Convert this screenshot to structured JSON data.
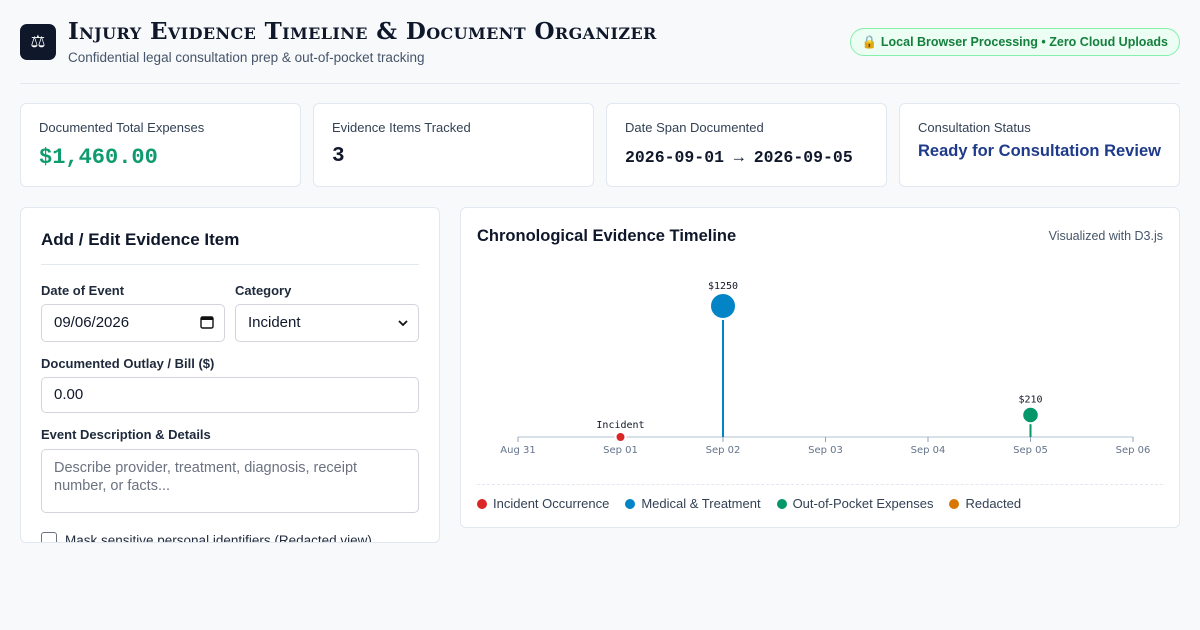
{
  "header": {
    "title": "Injury Evidence Timeline & Document Organizer",
    "subtitle": "Confidential legal consultation prep & out-of-pocket tracking",
    "logo_icon": "scales-icon",
    "privacy_badge": "🔒 Local Browser Processing • Zero Cloud Uploads"
  },
  "stats": [
    {
      "label": "Documented Total Expenses",
      "value": "$1,460.00"
    },
    {
      "label": "Evidence Items Tracked",
      "value": "3"
    },
    {
      "label": "Date Span Documented",
      "value": "2026-09-01 → 2026-09-05"
    },
    {
      "label": "Consultation Status",
      "value": "Ready for Consultation Review"
    }
  ],
  "form": {
    "title": "Add / Edit Evidence Item",
    "date_label": "Date of Event",
    "date_value": "09/06/2026",
    "category_label": "Category",
    "category_value": "Incident",
    "amount_label": "Documented Outlay / Bill ($)",
    "amount_value": "0.00",
    "description_label": "Event Description & Details",
    "description_placeholder": "Describe provider, treatment, diagnosis, receipt number, or facts...",
    "mask_label": "Mask sensitive personal identifiers (Redacted view)"
  },
  "timeline": {
    "title": "Chronological Evidence Timeline",
    "note": "Visualized with D3.js",
    "colors": {
      "incident": "#dc2626",
      "medical": "#0284c7",
      "expense": "#059669",
      "redacted": "#d97706"
    },
    "legend": [
      {
        "key": "incident",
        "label": "Incident Occurrence"
      },
      {
        "key": "medical",
        "label": "Medical & Treatment"
      },
      {
        "key": "expense",
        "label": "Out-of-Pocket Expenses"
      },
      {
        "key": "redacted",
        "label": "Redacted"
      }
    ]
  },
  "chart_data": {
    "type": "scatter",
    "x_ticks": [
      "Aug 31",
      "Sep 01",
      "Sep 02",
      "Sep 03",
      "Sep 04",
      "Sep 05",
      "Sep 06"
    ],
    "xlim": [
      "2026-08-31",
      "2026-09-06"
    ],
    "points": [
      {
        "date": "2026-09-01",
        "category": "incident",
        "amount": 0,
        "label": "Incident"
      },
      {
        "date": "2026-09-02",
        "category": "medical",
        "amount": 1250,
        "label": "$1250"
      },
      {
        "date": "2026-09-05",
        "category": "expense",
        "amount": 210,
        "label": "$210"
      }
    ]
  }
}
